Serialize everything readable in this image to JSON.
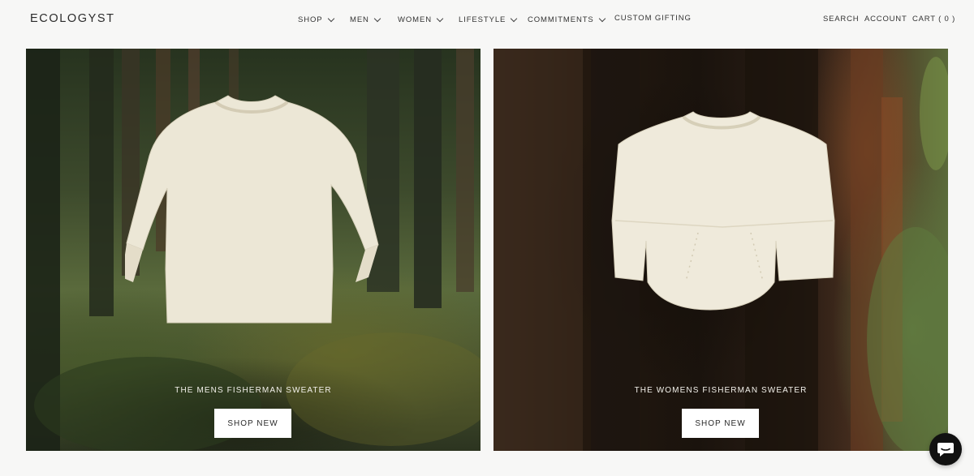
{
  "brand": {
    "logo_text": "ECOLOGYST"
  },
  "nav": {
    "items": [
      {
        "label": "SHOP",
        "has_dropdown": true
      },
      {
        "label": "MEN",
        "has_dropdown": true
      },
      {
        "label": "WOMEN",
        "has_dropdown": true
      },
      {
        "label": "LIFESTYLE",
        "has_dropdown": true
      },
      {
        "label": "COMMITMENTS",
        "has_dropdown": true
      },
      {
        "label": "CUSTOM GIFTING",
        "has_dropdown": false
      }
    ],
    "search": "SEARCH",
    "account": "ACCOUNT",
    "cart": "CART ( 0 )"
  },
  "panels": [
    {
      "caption": "THE MENS FISHERMAN SWEATER",
      "button": "SHOP NEW",
      "image": "mens-cream-sweater-forest"
    },
    {
      "caption": "THE WOMENS FISHERMAN SWEATER",
      "button": "SHOP NEW",
      "image": "womens-cream-sweater-redwood"
    }
  ],
  "chat": {
    "icon": "chat-bubble-icon"
  },
  "colors": {
    "background": "#f7f7f6",
    "text": "#2a2a2a",
    "sweater": "#ece7d6",
    "chat_button": "#111111"
  }
}
